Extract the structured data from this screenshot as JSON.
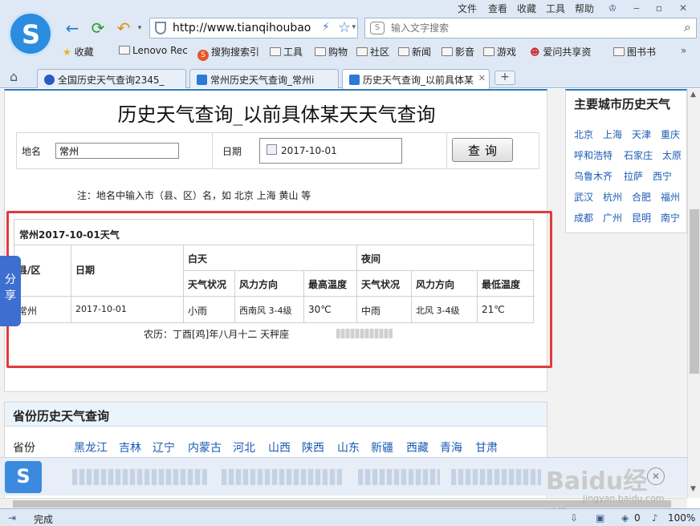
{
  "menubar": {
    "file": "文件",
    "view": "查看",
    "favorites": "收藏",
    "tools": "工具",
    "help": "帮助"
  },
  "address": {
    "url": "http://www.tianqihoubao"
  },
  "search": {
    "placeholder": "输入文字搜索"
  },
  "bookmarks": [
    "收藏",
    "Lenovo Rec",
    "搜狗搜索引",
    "工具",
    "购物",
    "社区",
    "新闻",
    "影音",
    "游戏",
    "爱问共享资",
    "图书书"
  ],
  "tabs": [
    {
      "label": "全国历史天气查询2345_"
    },
    {
      "label": "常州历史天气查询_常州i"
    },
    {
      "label": "历史天气查询_以前具体某"
    }
  ],
  "page": {
    "title": "历史天气查询_以前具体某天天气查询",
    "place_label": "地名",
    "place_value": "常州",
    "date_label": "日期",
    "date_value": "2017-10-01",
    "query_button": "查询",
    "note": "注：地名中输入市（县、区）名，如 北京 上海 黄山 等"
  },
  "result": {
    "title": "常州2017-10-01天气",
    "col_county": "县/区",
    "col_date": "日期",
    "day": "白天",
    "night": "夜间",
    "col_weather": "天气状况",
    "col_wind": "风力方向",
    "col_max": "最高温度",
    "col_weather2": "天气状况",
    "col_wind2": "风力方向",
    "col_min": "最低温度",
    "row": {
      "county": "常州",
      "date": "2017-10-01",
      "day_weather": "小雨",
      "day_wind": "西南风 3-4级",
      "max_temp": "30℃",
      "night_weather": "中雨",
      "night_wind": "北风 3-4级",
      "min_temp": "21℃"
    },
    "lunar": "农历：丁酉[鸡]年八月十二 天秤座"
  },
  "share": "分享",
  "side": {
    "title": "主要城市历史天气",
    "cities": [
      "北京",
      "上海",
      "天津",
      "重庆",
      "呼和浩特",
      "石家庄",
      "太原",
      "乌鲁木齐",
      "拉萨",
      "西宁",
      "武汉",
      "杭州",
      "合肥",
      "福州",
      "成都",
      "广州",
      "昆明",
      "南宁"
    ]
  },
  "province": {
    "title": "省份历史天气查询",
    "label": "省份",
    "items": [
      "黑龙江",
      "吉林",
      "辽宁",
      "内蒙古",
      "河北",
      "山西",
      "陕西",
      "山东",
      "新疆",
      "西藏",
      "青海",
      "甘肃"
    ]
  },
  "status": {
    "text": "完成",
    "zoom": "100%",
    "badge": "0"
  },
  "watermark": {
    "text": "Baidu经验",
    "sub": "jingyan.baidu.com"
  }
}
